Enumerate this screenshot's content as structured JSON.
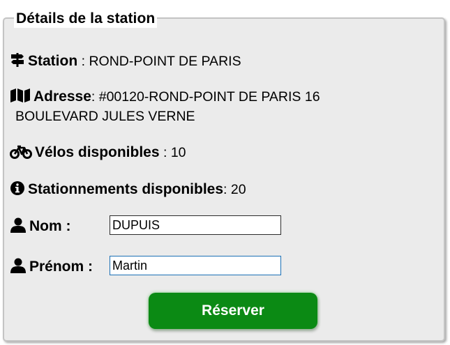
{
  "legend": "Détails de la station",
  "station": {
    "label": "Station",
    "sep": " : ",
    "value": "ROND-POINT DE PARIS"
  },
  "address": {
    "label": "Adresse",
    "sep": ": ",
    "line1": "#00120-ROND-POINT DE PARIS 16",
    "line2": "BOULEVARD JULES VERNE"
  },
  "bikes": {
    "label": "Vélos disponibles",
    "sep": " : ",
    "value": "10"
  },
  "parking": {
    "label": "Stationnements disponibles",
    "sep": ": ",
    "value": "20"
  },
  "nom": {
    "label": "Nom :",
    "value": "DUPUIS"
  },
  "prenom": {
    "label": "Prénom :",
    "value": "Martin"
  },
  "reserve_button": "Réserver",
  "icons": {
    "station": "signpost-icon",
    "address": "map-icon",
    "bikes": "bicycle-icon",
    "parking": "info-circle-icon",
    "nom": "user-icon",
    "prenom": "user-icon"
  },
  "colors": {
    "button": "#0b8a14",
    "panel": "#ebebeb"
  }
}
